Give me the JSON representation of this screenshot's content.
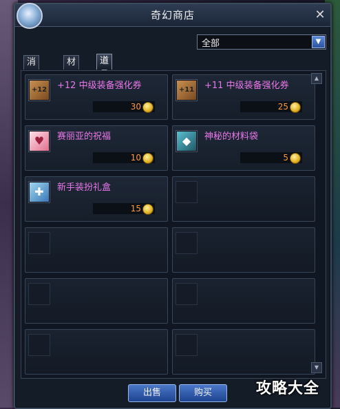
{
  "window": {
    "title": "奇幻商店",
    "close_glyph": "✕"
  },
  "filter": {
    "selected": "全部",
    "arrow_glyph": "▼"
  },
  "tabs": [
    {
      "label": "消耗品",
      "active": false
    },
    {
      "label": "材料",
      "active": false
    },
    {
      "label": "道具",
      "active": true
    }
  ],
  "items": [
    {
      "name": "+12 中级装备强化券",
      "price": "30",
      "icon": "scroll-icon",
      "icon_text": "+12"
    },
    {
      "name": "+11 中级装备强化券",
      "price": "25",
      "icon": "scroll-icon",
      "icon_text": "+11"
    },
    {
      "name": "赛丽亚的祝福",
      "price": "10",
      "icon": "girl-icon",
      "icon_text": "♥"
    },
    {
      "name": "神秘的材料袋",
      "price": "5",
      "icon": "bag-icon",
      "icon_text": "◆"
    },
    {
      "name": "新手装扮礼盒",
      "price": "15",
      "icon": "gift-icon",
      "icon_text": "✚"
    }
  ],
  "buttons": {
    "sell": "出售",
    "buy": "购买"
  },
  "watermark": "攻略大全",
  "colors": {
    "item_name": "#e878e8",
    "price": "#ff9a3c",
    "button": "#2a5cb8"
  }
}
